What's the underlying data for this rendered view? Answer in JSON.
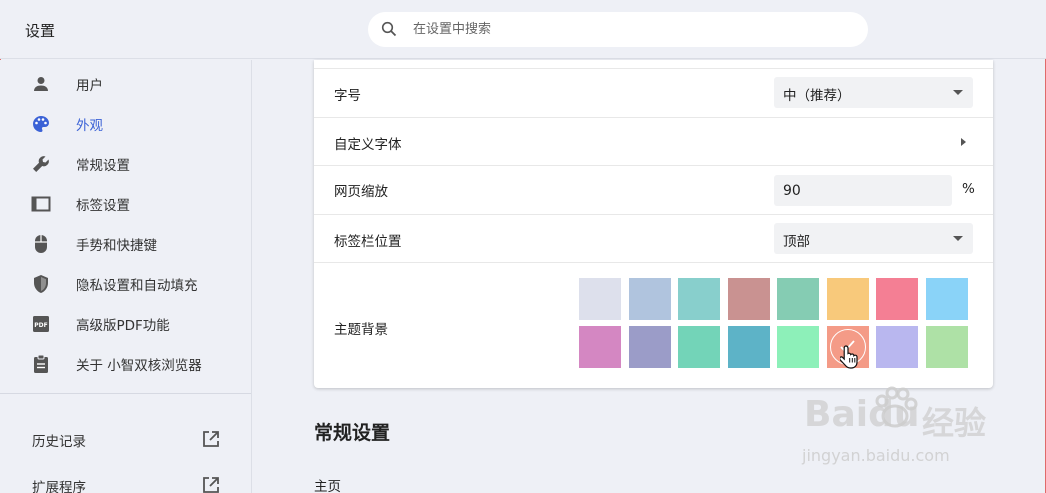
{
  "header": {
    "title": "设置",
    "search_placeholder": "在设置中搜索"
  },
  "sidebar": {
    "items": [
      {
        "label": "用户",
        "icon": "person-icon"
      },
      {
        "label": "外观",
        "icon": "palette-icon",
        "active": true
      },
      {
        "label": "常规设置",
        "icon": "wrench-icon"
      },
      {
        "label": "标签设置",
        "icon": "tab-icon"
      },
      {
        "label": "手势和快捷键",
        "icon": "mouse-icon"
      },
      {
        "label": "隐私设置和自动填充",
        "icon": "shield-icon"
      },
      {
        "label": "高级版PDF功能",
        "icon": "pdf-icon"
      },
      {
        "label": "关于 小智双核浏览器",
        "icon": "clipboard-icon"
      }
    ],
    "links": [
      {
        "label": "历史记录",
        "icon": "external-link-icon"
      },
      {
        "label": "扩展程序",
        "icon": "external-link-icon"
      }
    ]
  },
  "appearance": {
    "font_size": {
      "label": "字号",
      "value": "中（推荐）"
    },
    "custom_font": {
      "label": "自定义字体"
    },
    "zoom": {
      "label": "网页缩放",
      "value": "90",
      "unit": "%"
    },
    "tab_bar_position": {
      "label": "标签栏位置",
      "value": "顶部"
    },
    "theme": {
      "label": "主题背景",
      "colors": [
        "#dde0ec",
        "#b0c4de",
        "#88cfcc",
        "#c99291",
        "#85ccb3",
        "#f8c97b",
        "#f47f94",
        "#8ad3f8",
        "#d487c2",
        "#9b9cc8",
        "#73d4b8",
        "#5db3c7",
        "#8df0b9",
        "#f49b87",
        "#b9b7ef",
        "#aee1a6"
      ],
      "selected_index": 13
    }
  },
  "general_section": {
    "title": "常规设置",
    "home_label": "主页"
  },
  "watermark": {
    "brand": "Baidu",
    "brand_cn": "经验",
    "url": "jingyan.baidu.com"
  }
}
